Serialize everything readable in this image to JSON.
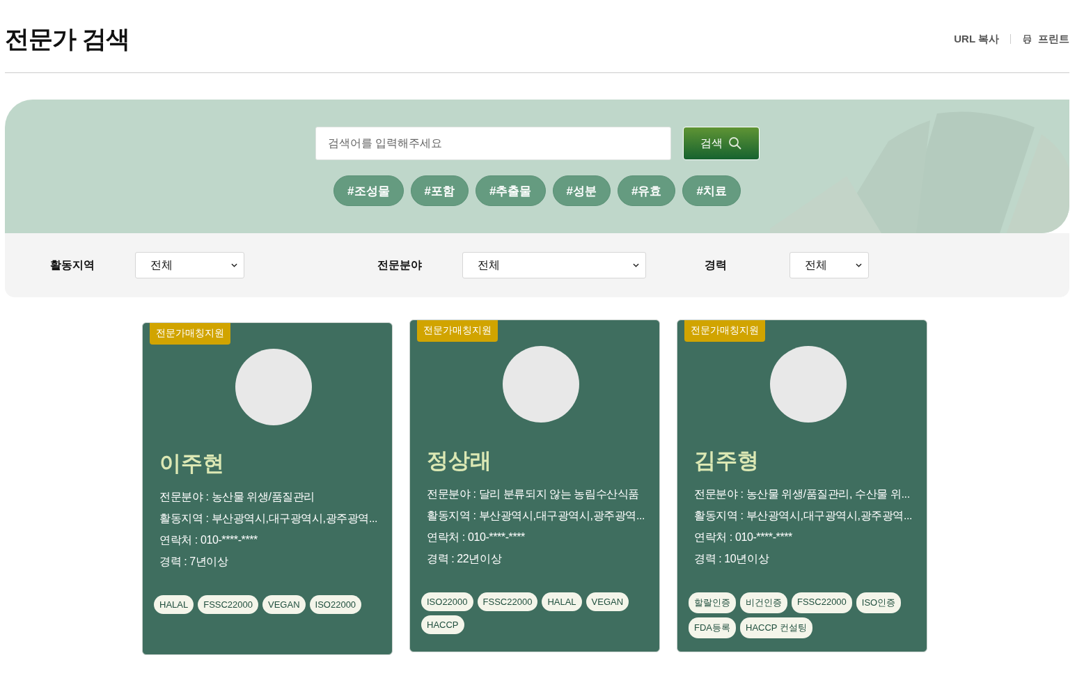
{
  "header": {
    "title": "전문가 검색",
    "actions": [
      {
        "kind": "link",
        "label": "URL 복사"
      },
      {
        "kind": "print",
        "label": "프린트"
      }
    ]
  },
  "search": {
    "placeholder": "검색어를 입력해주세요",
    "button": "검색",
    "hashtags": [
      "#조성물",
      "#포함",
      "#추출물",
      "#성분",
      "#유효",
      "#치료"
    ]
  },
  "filters": [
    {
      "label": "활동지역",
      "value": "전체"
    },
    {
      "label": "전문분야",
      "value": "전체"
    },
    {
      "label": "경력",
      "value": "전체"
    }
  ],
  "experts": [
    {
      "badge": "전문가매칭지원",
      "name": "이주현",
      "details": [
        "전문분야 : 농산물 위생/품질관리",
        "활동지역 : 부산광역시,대구광역시,광주광역...",
        "연락처 : 010-****-****",
        "경력 : 7년이상"
      ],
      "tags": [
        "HALAL",
        "FSSC22000",
        "VEGAN",
        "ISO22000"
      ]
    },
    {
      "badge": "전문가매칭지원",
      "name": "정상래",
      "details": [
        "전문분야 : 달리 분류되지 않는 농림수산식품",
        "활동지역 : 부산광역시,대구광역시,광주광역...",
        "연락처 : 010-****-****",
        "경력 : 22년이상"
      ],
      "tags": [
        "ISO22000",
        "FSSC22000",
        "HALAL",
        "VEGAN",
        "HACCP"
      ]
    },
    {
      "badge": "전문가매칭지원",
      "name": "김주형",
      "details": [
        "전문분야 : 농산물 위생/품질관리, 수산물 위...",
        "활동지역 : 부산광역시,대구광역시,광주광역...",
        "연락처 : 010-****-****",
        "경력 : 10년이상"
      ],
      "tags": [
        "할랄인증",
        "비건인증",
        "FSSC22000",
        "ISO인증",
        "FDA등록",
        "HACCP 컨설팅"
      ]
    }
  ]
}
